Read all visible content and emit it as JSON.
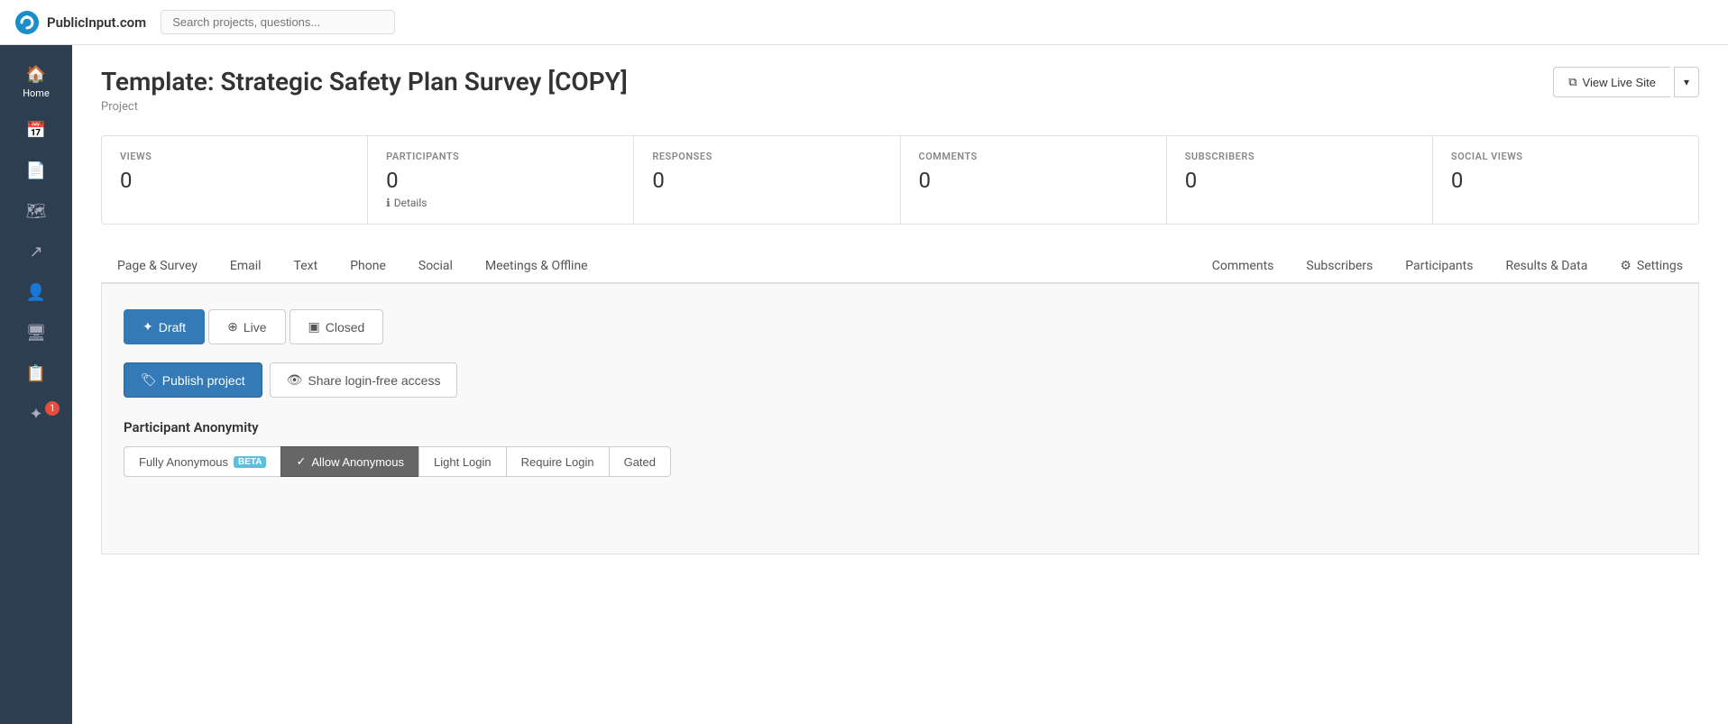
{
  "app": {
    "name": "PublicInput.com"
  },
  "topbar": {
    "search_placeholder": "Search projects, questions..."
  },
  "page": {
    "title": "Template: Strategic Safety Plan Survey [COPY]",
    "subtitle": "Project"
  },
  "header_actions": {
    "view_live": "View Live Site",
    "dropdown_icon": "▾"
  },
  "stats": [
    {
      "label": "VIEWS",
      "value": "0"
    },
    {
      "label": "PARTICIPANTS",
      "value": "0",
      "details": "Details"
    },
    {
      "label": "RESPONSES",
      "value": "0"
    },
    {
      "label": "COMMENTS",
      "value": "0"
    },
    {
      "label": "SUBSCRIBERS",
      "value": "0"
    },
    {
      "label": "SOCIAL VIEWS",
      "value": "0"
    }
  ],
  "tabs": [
    {
      "label": "Page & Survey",
      "active": false
    },
    {
      "label": "Email",
      "active": false
    },
    {
      "label": "Text",
      "active": false
    },
    {
      "label": "Phone",
      "active": false
    },
    {
      "label": "Social",
      "active": false
    },
    {
      "label": "Meetings & Offline",
      "active": false
    },
    {
      "label": "Comments",
      "active": false
    },
    {
      "label": "Subscribers",
      "active": false
    },
    {
      "label": "Participants",
      "active": false
    },
    {
      "label": "Results & Data",
      "active": false
    },
    {
      "label": "⚙ Settings",
      "active": false
    }
  ],
  "status_buttons": [
    {
      "label": "Draft",
      "icon": "✦",
      "active": true
    },
    {
      "label": "Live",
      "icon": "⊕",
      "active": false
    },
    {
      "label": "Closed",
      "icon": "▣",
      "active": false
    }
  ],
  "action_buttons": {
    "publish": "Publish project",
    "share": "Share login-free access",
    "publish_icon": "🏷",
    "share_icon": "👁"
  },
  "anonymity": {
    "title": "Participant Anonymity",
    "options": [
      {
        "label": "Fully Anonymous",
        "beta": true,
        "active": false
      },
      {
        "label": "Allow Anonymous",
        "active": true
      },
      {
        "label": "Light Login",
        "active": false
      },
      {
        "label": "Require Login",
        "active": false
      },
      {
        "label": "Gated",
        "active": false
      }
    ]
  },
  "sidebar": {
    "items": [
      {
        "icon": "🏠",
        "label": "Home",
        "active": true
      },
      {
        "icon": "📅",
        "label": "",
        "active": false
      },
      {
        "icon": "📄",
        "label": "",
        "active": false
      },
      {
        "icon": "🗺",
        "label": "",
        "active": false
      },
      {
        "icon": "↗",
        "label": "",
        "active": false
      },
      {
        "icon": "👤",
        "label": "",
        "active": false
      },
      {
        "icon": "🖥",
        "label": "",
        "active": false
      },
      {
        "icon": "📋",
        "label": "",
        "active": false
      },
      {
        "icon": "✦",
        "label": "",
        "active": false,
        "badge": "1"
      }
    ]
  }
}
